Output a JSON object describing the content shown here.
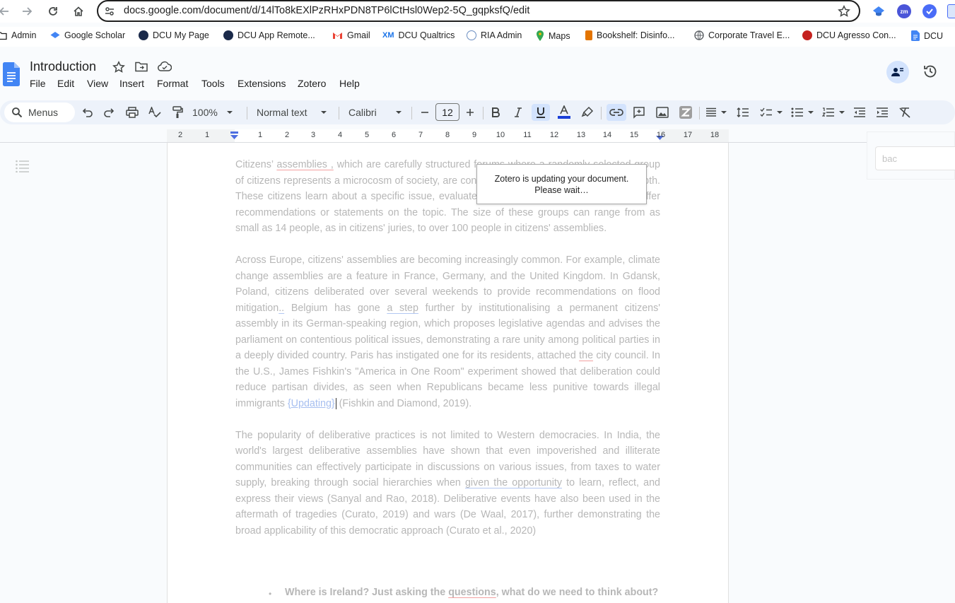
{
  "browser": {
    "url": "docs.google.com/document/d/14lTo8kEXlPzRHxPDN8TP6lCtHsl0Wep2-5Q_gqpksfQ/edit",
    "bookmarks": [
      {
        "label": "Admin",
        "icon": "folder-icon",
        "color": "#1f1f1f"
      },
      {
        "label": "Google Scholar",
        "icon": "scholar-icon",
        "color": "#4285f4"
      },
      {
        "label": "DCU My Page",
        "icon": "dcu-icon",
        "color": "#1b2a4a"
      },
      {
        "label": "DCU App  Remote...",
        "icon": "dcu-icon",
        "color": "#1b2a4a"
      },
      {
        "label": "Gmail",
        "icon": "gmail-icon",
        "color": "#ea4335"
      },
      {
        "label": "DCU Qualtrics",
        "icon": "qualtrics-icon",
        "color": "#1a73e8"
      },
      {
        "label": "RIA Admin",
        "icon": "ria-icon",
        "color": "#6b8ec2"
      },
      {
        "label": "Maps",
        "icon": "maps-icon",
        "color": "#34a853"
      },
      {
        "label": "Bookshelf: Disinfo...",
        "icon": "bookshelf-icon",
        "color": "#e37400"
      },
      {
        "label": "Corporate Travel E...",
        "icon": "globe-icon",
        "color": "#5f6368"
      },
      {
        "label": "DCU Agresso Con...",
        "icon": "agresso-icon",
        "color": "#c5221f"
      },
      {
        "label": "DCU",
        "icon": "docs-icon",
        "color": "#4285f4"
      }
    ]
  },
  "doc": {
    "title": "Introduction",
    "menu": [
      "File",
      "Edit",
      "View",
      "Insert",
      "Format",
      "Tools",
      "Extensions",
      "Zotero",
      "Help"
    ]
  },
  "toolbar": {
    "search_label": "Menus",
    "zoom": "100%",
    "style": "Normal text",
    "font": "Calibri",
    "font_size": "12"
  },
  "ruler": {
    "left_numbers": [
      "2",
      "1"
    ],
    "right_numbers": [
      "1",
      "2",
      "3",
      "4",
      "5",
      "6",
      "7",
      "8",
      "9",
      "10",
      "11",
      "12",
      "13",
      "14",
      "15",
      "16",
      "17",
      "18"
    ]
  },
  "content": {
    "p1_parts": {
      "a": "Citizens’ ",
      "b": "assemblies ,",
      "c": " which are carefully structured forums where a randomly selected group of citizens represents a microcosm of society, are convened to deliberate on an issue in depth. These citizens learn about a specific issue, evaluate the evidence and arguments, and offer recommendations or statements on the topic. The size of these groups can range from as small as 14 people, as in citizens' juries, to over 100 people in citizens' assemblies."
    },
    "p2_parts": {
      "a": "Across Europe, citizens' assemblies are becoming increasingly common. For example, climate change assemblies are a feature in France, Germany, and the United Kingdom. In Gdansk, Poland, citizens deliberated over several weekends to provide recommendations on flood mitigation",
      "b": "..",
      "c": " Belgium has gone ",
      "d": "a step",
      "e": " further by institutionalising a permanent citizens' assembly in its German-speaking region, which proposes legislative agendas and advises the parliament on contentious political issues, demonstrating a rare unity among political parties in a deeply divided country. Paris has instigated one for its residents, attached ",
      "f": "the",
      "g": " city council. In the U.S., James Fishkin's \"America in One Room\" experiment showed that deliberation could reduce partisan divides, as seen when Republicans became less punitive towards illegal immigrants ",
      "updating": "{Updating}",
      "h": " (Fishkin and Diamond, 2019)."
    },
    "p3_parts": {
      "a": "The popularity of deliberative practices is not limited to Western democracies. In India, the world's largest deliberative assemblies have shown that even impoverished and illiterate communities can effectively participate in discussions on various issues, from taxes to water supply, breaking through social hierarchies when ",
      "b": "given the opportunity",
      "c": " to learn, reflect, and express their views (Sanyal and Rao, 2018). Deliberative events have also been used in the aftermath of tragedies (Curato, 2019) and wars (De Waal, 2017), further demonstrating the broad applicability of this democratic approach (Curato et al., 2020)"
    },
    "heading_parts": {
      "a": "Where is Ireland? Just asking the ",
      "b": "questions",
      "c": ", what do we need to think about?"
    }
  },
  "zotero_dialog": {
    "line1": "Zotero is updating your document.",
    "line2": "Please wait…"
  },
  "side_panel": {
    "input_value": "bac"
  },
  "colors": {
    "accent": "#1a73e8",
    "docs_blue": "#4285f4",
    "toolbar_bg": "#edf2fa",
    "active_button": "#d3e3fd",
    "faded_text": "#b7b7b7"
  }
}
